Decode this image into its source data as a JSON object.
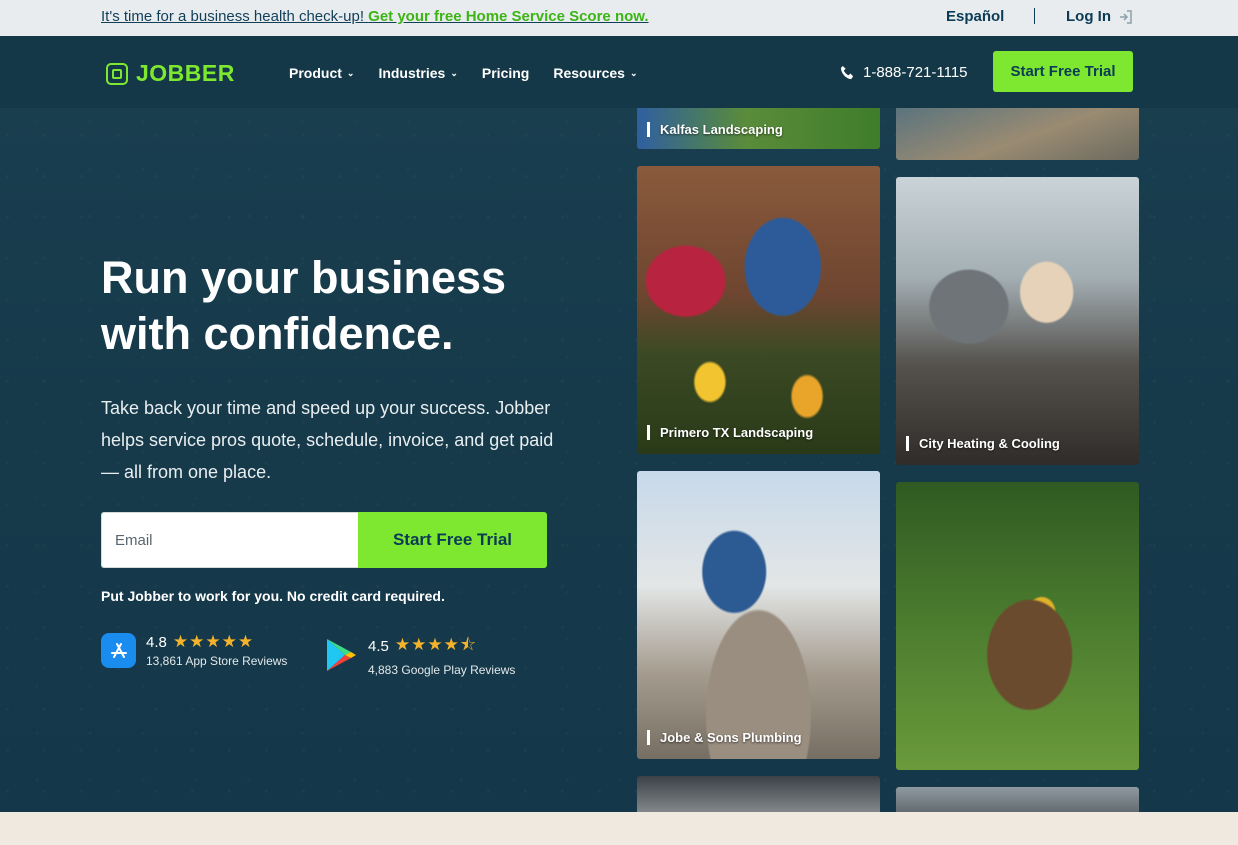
{
  "announcement": {
    "text": "It's time for a business health check-up!",
    "link": "Get your free Home Service Score now."
  },
  "topbar": {
    "language": "Español",
    "login": "Log In"
  },
  "nav": {
    "logo": "JOBBER",
    "menu": [
      {
        "label": "Product",
        "dropdown": true
      },
      {
        "label": "Industries",
        "dropdown": true
      },
      {
        "label": "Pricing",
        "dropdown": false
      },
      {
        "label": "Resources",
        "dropdown": true
      }
    ],
    "phone": "1-888-721-1115",
    "cta": "Start Free Trial"
  },
  "hero": {
    "title_line1": "Run your business",
    "title_line2": "with confidence.",
    "subtitle": "Take back your time and speed up your success. Jobber helps service pros quote, schedule, invoice, and get paid — all from one place.",
    "email_placeholder": "Email",
    "cta": "Start Free Trial",
    "note": "Put Jobber to work for you. No credit card required."
  },
  "ratings": [
    {
      "store": "App Store",
      "score": "4.8",
      "stars": "★★★★★",
      "reviews": "13,861 App Store Reviews"
    },
    {
      "store": "Google Play",
      "score": "4.5",
      "stars": "★★★★⯪",
      "reviews": "4,883 Google Play Reviews"
    }
  ],
  "photos": [
    {
      "caption": "Kalfas Landscaping"
    },
    {
      "caption": ""
    },
    {
      "caption": "Primero TX Landscaping"
    },
    {
      "caption": "City Heating & Cooling"
    },
    {
      "caption": "Jobe & Sons Plumbing"
    },
    {
      "caption": ""
    },
    {
      "caption": ""
    },
    {
      "caption": ""
    }
  ],
  "colors": {
    "brand_green": "#7ee831",
    "navy": "#163a4a",
    "star": "#f4b32a"
  }
}
